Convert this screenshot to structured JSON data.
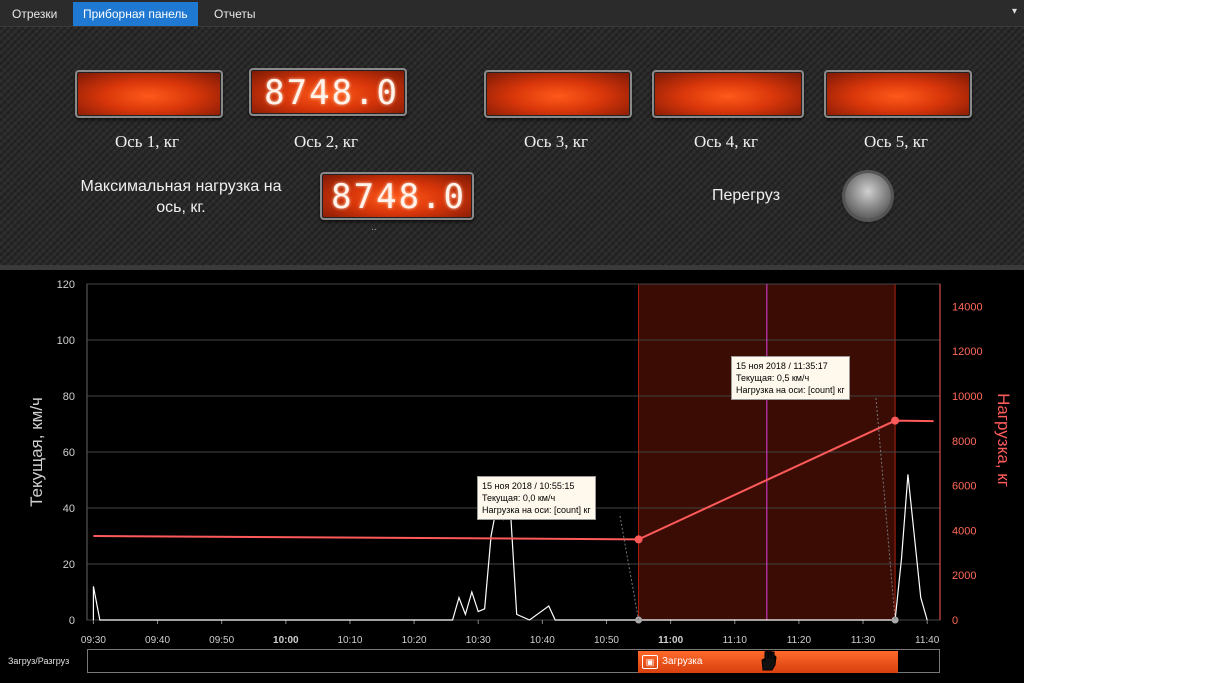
{
  "tabs": [
    {
      "label": "Отрезки",
      "active": false
    },
    {
      "label": "Приборная панель",
      "active": true
    },
    {
      "label": "Отчеты",
      "active": false
    }
  ],
  "dashboard": {
    "axles": [
      {
        "label": "Ось 1, кг",
        "value": ""
      },
      {
        "label": "Ось 2, кг",
        "value": "8748.0"
      },
      {
        "label": "Ось 3, кг",
        "value": ""
      },
      {
        "label": "Ось 4, кг",
        "value": ""
      },
      {
        "label": "Ось 5, кг",
        "value": ""
      }
    ],
    "max_load_label": "Максимальная нагрузка на ось, кг.",
    "max_load_value": "8748.0",
    "max_load_sub": "..",
    "overload_label": "Перегруз",
    "overload_lamp_on": false,
    "display_color": "#e04010"
  },
  "chart_data": {
    "type": "line",
    "y_left_label": "Текущая, км/ч",
    "y_right_label": "Нагрузка, кг",
    "y_left_ticks": [
      "120",
      "100",
      "80",
      "60",
      "40",
      "20",
      "0"
    ],
    "y_right_ticks": [
      "14000",
      "12000",
      "10000",
      "8000",
      "6000",
      "4000",
      "2000",
      "0"
    ],
    "x_ticks": [
      "09:30",
      "09:40",
      "09:50",
      "10:00",
      "10:10",
      "10:20",
      "10:30",
      "10:40",
      "10:50",
      "11:00",
      "11:10",
      "11:20",
      "11:30",
      "11:40"
    ],
    "x_ticks_bold": [
      "10:00",
      "11:00"
    ],
    "ylim_left": [
      0,
      120
    ],
    "ylim_right": [
      0,
      15000
    ],
    "grid": true,
    "series": [
      {
        "name": "Текущая, км/ч",
        "color": "#ffffff",
        "axis": "left",
        "points": [
          [
            "09:30",
            0
          ],
          [
            "09:30",
            12
          ],
          [
            "09:31",
            0
          ],
          [
            "10:26",
            0
          ],
          [
            "10:27",
            8
          ],
          [
            "10:28",
            2
          ],
          [
            "10:29",
            10
          ],
          [
            "10:30",
            3
          ],
          [
            "10:31",
            4
          ],
          [
            "10:32",
            30
          ],
          [
            "10:33",
            42
          ],
          [
            "10:34",
            36
          ],
          [
            "10:35",
            40
          ],
          [
            "10:36",
            2
          ],
          [
            "10:38",
            0
          ],
          [
            "10:41",
            5
          ],
          [
            "10:42",
            0
          ],
          [
            "10:56",
            0
          ],
          [
            "11:35",
            0
          ],
          [
            "11:36",
            22
          ],
          [
            "11:37",
            52
          ],
          [
            "11:38",
            30
          ],
          [
            "11:39",
            8
          ],
          [
            "11:40",
            0
          ]
        ]
      },
      {
        "name": "Нагрузка, кг",
        "color": "#ff5a5a",
        "axis": "right",
        "points": [
          [
            "09:30",
            3750
          ],
          [
            "10:55",
            3600
          ],
          [
            "11:35",
            8900
          ],
          [
            "11:41",
            8880
          ]
        ]
      }
    ],
    "highlight_range": [
      "10:55",
      "11:35"
    ],
    "marker_time": "11:15",
    "tooltips": [
      {
        "time": "15 ноя 2018 / 10:55:15",
        "speed": "Текущая: 0,0 км/ч",
        "load": "Нагрузка на оси: [count] кг"
      },
      {
        "time": "15 ноя 2018 / 11:35:17",
        "speed": "Текущая: 0,5 км/ч",
        "load": "Нагрузка на оси: [count] кг"
      }
    ]
  },
  "timeline": {
    "row_label": "Загруз/Разгруз",
    "event_label": "Загрузка",
    "event_icon": "truck-icon",
    "event_color": "#e8501a",
    "cursor_icon": "hand-icon"
  }
}
